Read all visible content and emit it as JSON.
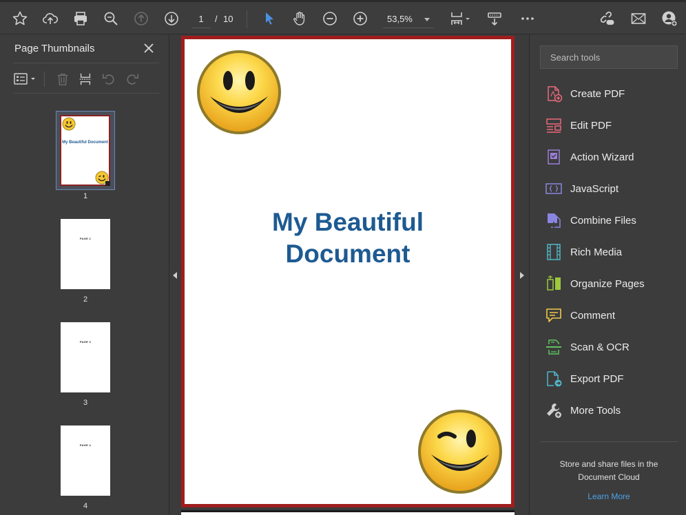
{
  "toolbar": {
    "page_current": "1",
    "page_separator": "/",
    "page_total": "10",
    "zoom": "53,5%",
    "icons": [
      "star-icon",
      "cloud-upload-icon",
      "print-icon",
      "magnify-icon",
      "page-up-icon",
      "page-down-icon",
      "select-arrow-icon",
      "hand-icon",
      "zoom-out-icon",
      "zoom-in-icon",
      "fit-page-icon",
      "scroll-mode-icon",
      "more-icon",
      "share-link-icon",
      "mail-icon",
      "account-icon"
    ]
  },
  "left_panel": {
    "title": "Page Thumbnails",
    "thumbnails": [
      {
        "number": "1",
        "title": "My Beautiful Document"
      },
      {
        "number": "2",
        "label": "PAGE 2"
      },
      {
        "number": "3",
        "label": "PAGE 3"
      },
      {
        "number": "4",
        "label": "PAGE 4"
      }
    ]
  },
  "document": {
    "title_line1": "My Beautiful",
    "title_line2": "Document"
  },
  "right_panel": {
    "search_placeholder": "Search tools",
    "tools": [
      {
        "label": "Create PDF",
        "icon": "create-pdf-icon",
        "color": "#e8697a"
      },
      {
        "label": "Edit PDF",
        "icon": "edit-pdf-icon",
        "color": "#e8697a"
      },
      {
        "label": "Action Wizard",
        "icon": "action-wizard-icon",
        "color": "#9b7fd6"
      },
      {
        "label": "JavaScript",
        "icon": "javascript-icon",
        "color": "#8a86e0"
      },
      {
        "label": "Combine Files",
        "icon": "combine-files-icon",
        "color": "#8a86e0"
      },
      {
        "label": "Rich Media",
        "icon": "rich-media-icon",
        "color": "#4fb6c7"
      },
      {
        "label": "Organize Pages",
        "icon": "organize-pages-icon",
        "color": "#9cc93d"
      },
      {
        "label": "Comment",
        "icon": "comment-icon",
        "color": "#f2c94c"
      },
      {
        "label": "Scan & OCR",
        "icon": "scan-ocr-icon",
        "color": "#5fc35f"
      },
      {
        "label": "Export PDF",
        "icon": "export-pdf-icon",
        "color": "#4fb6c7"
      },
      {
        "label": "More Tools",
        "icon": "more-tools-icon",
        "color": "#d0d0d0"
      }
    ],
    "promo_line1": "Store and share files in the",
    "promo_line2": "Document Cloud",
    "learn_more": "Learn More"
  },
  "colors": {
    "accent_blue": "#4a90e2",
    "page_border": "#a11d1d",
    "doc_title": "#1e5a92"
  }
}
